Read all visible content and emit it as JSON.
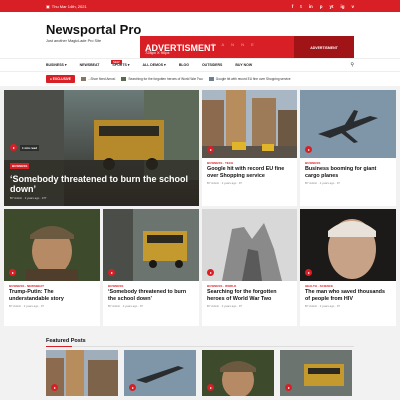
{
  "topbar": {
    "date": "Thu Mar 14th, 2021",
    "socials": [
      "f",
      "t",
      "in",
      "p",
      "yt",
      "ig",
      "v"
    ]
  },
  "site": {
    "name": "Newsportal Pro",
    "tagline": "Just another MagicLade Pro Site"
  },
  "ad": {
    "title": "ADVERTISMENT",
    "size": "728px X 90px",
    "word": "B A N N E",
    "panel": "ADVERTISMENT"
  },
  "nav": {
    "items": [
      "BUSINESS ▾",
      "NEWSBEAT",
      "SPORTS ▾",
      "ALL DEMOS ▾",
      "BLOG",
      "OUTSIDERS",
      "BUY NOW"
    ],
    "new_badge": "NEW"
  },
  "ticker": {
    "badge": "● EXCLUSIVE",
    "items": [
      "...Shoe fixed Amos!",
      "Searching for the forgotten heroes of World War Two",
      "Google hit with record EU fine over Shopping service"
    ]
  },
  "hero": {
    "category": "BUSINESS",
    "title": "‘Somebody threatened to burn the school down’",
    "meta": "BY Admin · 2 years ago · 477",
    "duration": "1 min read"
  },
  "cards": [
    {
      "category": "BUSINESS · TECH",
      "title": "Google hit with record EU fine over Shopping service",
      "meta": "BY Admin · 2 years ago · 97"
    },
    {
      "category": "BUSINESS",
      "title": "Business booming for giant cargo planes",
      "meta": "BY Admin · 2 years ago · 97"
    },
    {
      "category": "BUSINESS · NEWSBEAT",
      "title": "Trump-Putin: The understandable story",
      "meta": "BY Admin · 2 years ago · 97"
    },
    {
      "category": "BUSINESS",
      "title": "‘Somebody threatened to burn the school down’",
      "meta": "BY Admin · 2 years ago · 97"
    },
    {
      "category": "BUSINESS · WORLD",
      "title": "Searching for the forgotten heroes of World War Two",
      "meta": "BY Admin · 2 years ago · 97"
    },
    {
      "category": "HEALTH · SCIENCE",
      "title": "The man who saved thousands of people from HIV",
      "meta": "BY Admin · 2 years ago · 97"
    }
  ],
  "featured": {
    "title": "Featured Posts"
  },
  "colors": {
    "accent": "#d81f26"
  }
}
